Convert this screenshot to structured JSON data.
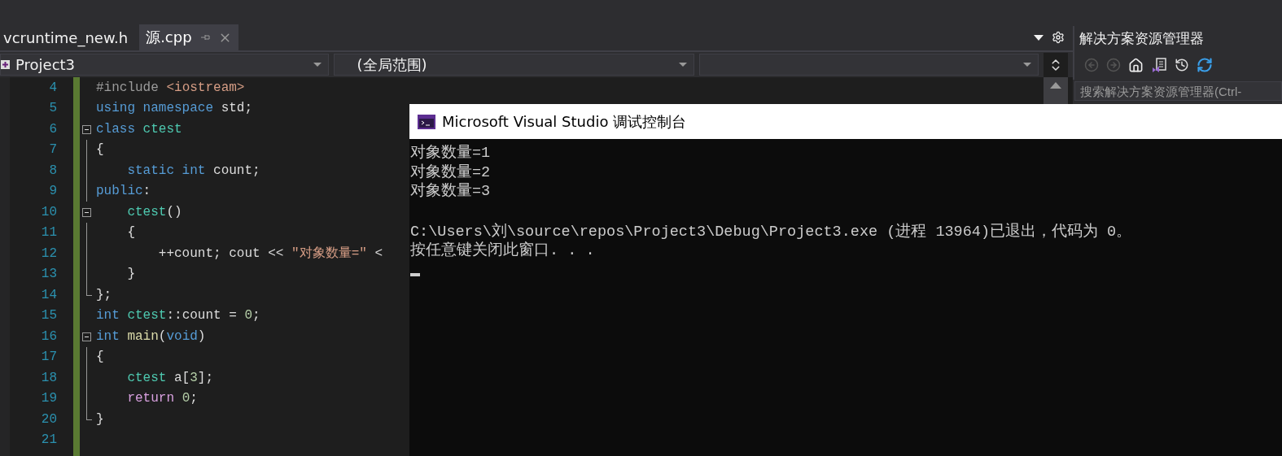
{
  "tabs": [
    {
      "label": "vcruntime_new.h",
      "selected": false
    },
    {
      "label": "源.cpp",
      "selected": true
    }
  ],
  "nav_bar": {
    "project": "Project3",
    "scope": "(全局范围)"
  },
  "editor": {
    "lines": [
      {
        "number": "4",
        "tokens": [
          {
            "kind": "directive",
            "text": "#include "
          },
          {
            "kind": "string",
            "text": "<iostream>"
          }
        ]
      },
      {
        "number": "5",
        "tokens": [
          {
            "kind": "keyword",
            "text": "using namespace "
          },
          {
            "kind": "plain",
            "text": "std;"
          }
        ]
      },
      {
        "number": "6",
        "kind": "start",
        "tokens": [
          {
            "kind": "keyword",
            "text": "class "
          },
          {
            "kind": "type",
            "text": "ctest"
          }
        ]
      },
      {
        "number": "7",
        "kind": "mid",
        "tokens": [
          {
            "kind": "plain",
            "text": "{"
          }
        ]
      },
      {
        "number": "8",
        "kind": "mid",
        "tokens": [
          {
            "kind": "keyword",
            "text": "    static int "
          },
          {
            "kind": "plain",
            "text": "count;"
          }
        ]
      },
      {
        "number": "9",
        "kind": "mid",
        "tokens": [
          {
            "kind": "keyword",
            "text": "public"
          },
          {
            "kind": "plain",
            "text": ":"
          }
        ]
      },
      {
        "number": "10",
        "kind": "start",
        "tokens": [
          {
            "kind": "type",
            "text": "    ctest"
          },
          {
            "kind": "plain",
            "text": "()"
          }
        ]
      },
      {
        "number": "11",
        "kind": "mid",
        "tokens": [
          {
            "kind": "plain",
            "text": "    {"
          }
        ]
      },
      {
        "number": "12",
        "kind": "mid",
        "tokens": [
          {
            "kind": "plain",
            "text": "        ++count; cout << "
          },
          {
            "kind": "string",
            "text": "\"对象数量=\""
          },
          {
            "kind": "plain",
            "text": " <"
          }
        ]
      },
      {
        "number": "13",
        "kind": "mid",
        "tokens": [
          {
            "kind": "plain",
            "text": "    }"
          }
        ]
      },
      {
        "number": "14",
        "kind": "end",
        "tokens": [
          {
            "kind": "plain",
            "text": "};"
          }
        ]
      },
      {
        "number": "15",
        "tokens": [
          {
            "kind": "keyword",
            "text": "int "
          },
          {
            "kind": "type",
            "text": "ctest"
          },
          {
            "kind": "plain",
            "text": "::count = "
          },
          {
            "kind": "number",
            "text": "0"
          },
          {
            "kind": "plain",
            "text": ";"
          }
        ]
      },
      {
        "number": "16",
        "kind": "start",
        "tokens": [
          {
            "kind": "keyword",
            "text": "int "
          },
          {
            "kind": "function",
            "text": "main"
          },
          {
            "kind": "plain",
            "text": "("
          },
          {
            "kind": "keyword",
            "text": "void"
          },
          {
            "kind": "plain",
            "text": ")"
          }
        ]
      },
      {
        "number": "17",
        "kind": "mid",
        "tokens": [
          {
            "kind": "plain",
            "text": "{"
          }
        ]
      },
      {
        "number": "18",
        "kind": "mid",
        "tokens": [
          {
            "kind": "type",
            "text": "    ctest "
          },
          {
            "kind": "plain",
            "text": "a["
          },
          {
            "kind": "number",
            "text": "3"
          },
          {
            "kind": "plain",
            "text": "];"
          }
        ]
      },
      {
        "number": "19",
        "kind": "mid",
        "tokens": [
          {
            "kind": "control",
            "text": "    return "
          },
          {
            "kind": "number",
            "text": "0"
          },
          {
            "kind": "plain",
            "text": ";"
          }
        ]
      },
      {
        "number": "20",
        "kind": "end",
        "tokens": [
          {
            "kind": "plain",
            "text": "}"
          }
        ]
      },
      {
        "number": "21"
      }
    ]
  },
  "solution_explorer": {
    "title": "解决方案资源管理器",
    "toolbar": [
      {
        "kind": "back",
        "disabled": true
      },
      {
        "kind": "forward",
        "disabled": true
      },
      {
        "kind": "home",
        "disabled": false
      },
      {
        "kind": "project-file",
        "disabled": false
      },
      {
        "kind": "history",
        "disabled": false
      },
      {
        "kind": "refresh",
        "disabled": false
      }
    ],
    "search": {
      "placeholder": "搜索解决方案资源管理器(Ctrl-"
    }
  },
  "console": {
    "title": "Microsoft Visual Studio 调试控制台",
    "output": [
      "对象数量=1",
      "对象数量=2",
      "对象数量=3"
    ],
    "message": [
      "C:\\Users\\刘\\source\\repos\\Project3\\Debug\\Project3.exe (进程 13964)已退出，代码为 0。",
      "按任意键关闭此窗口. . ."
    ]
  }
}
